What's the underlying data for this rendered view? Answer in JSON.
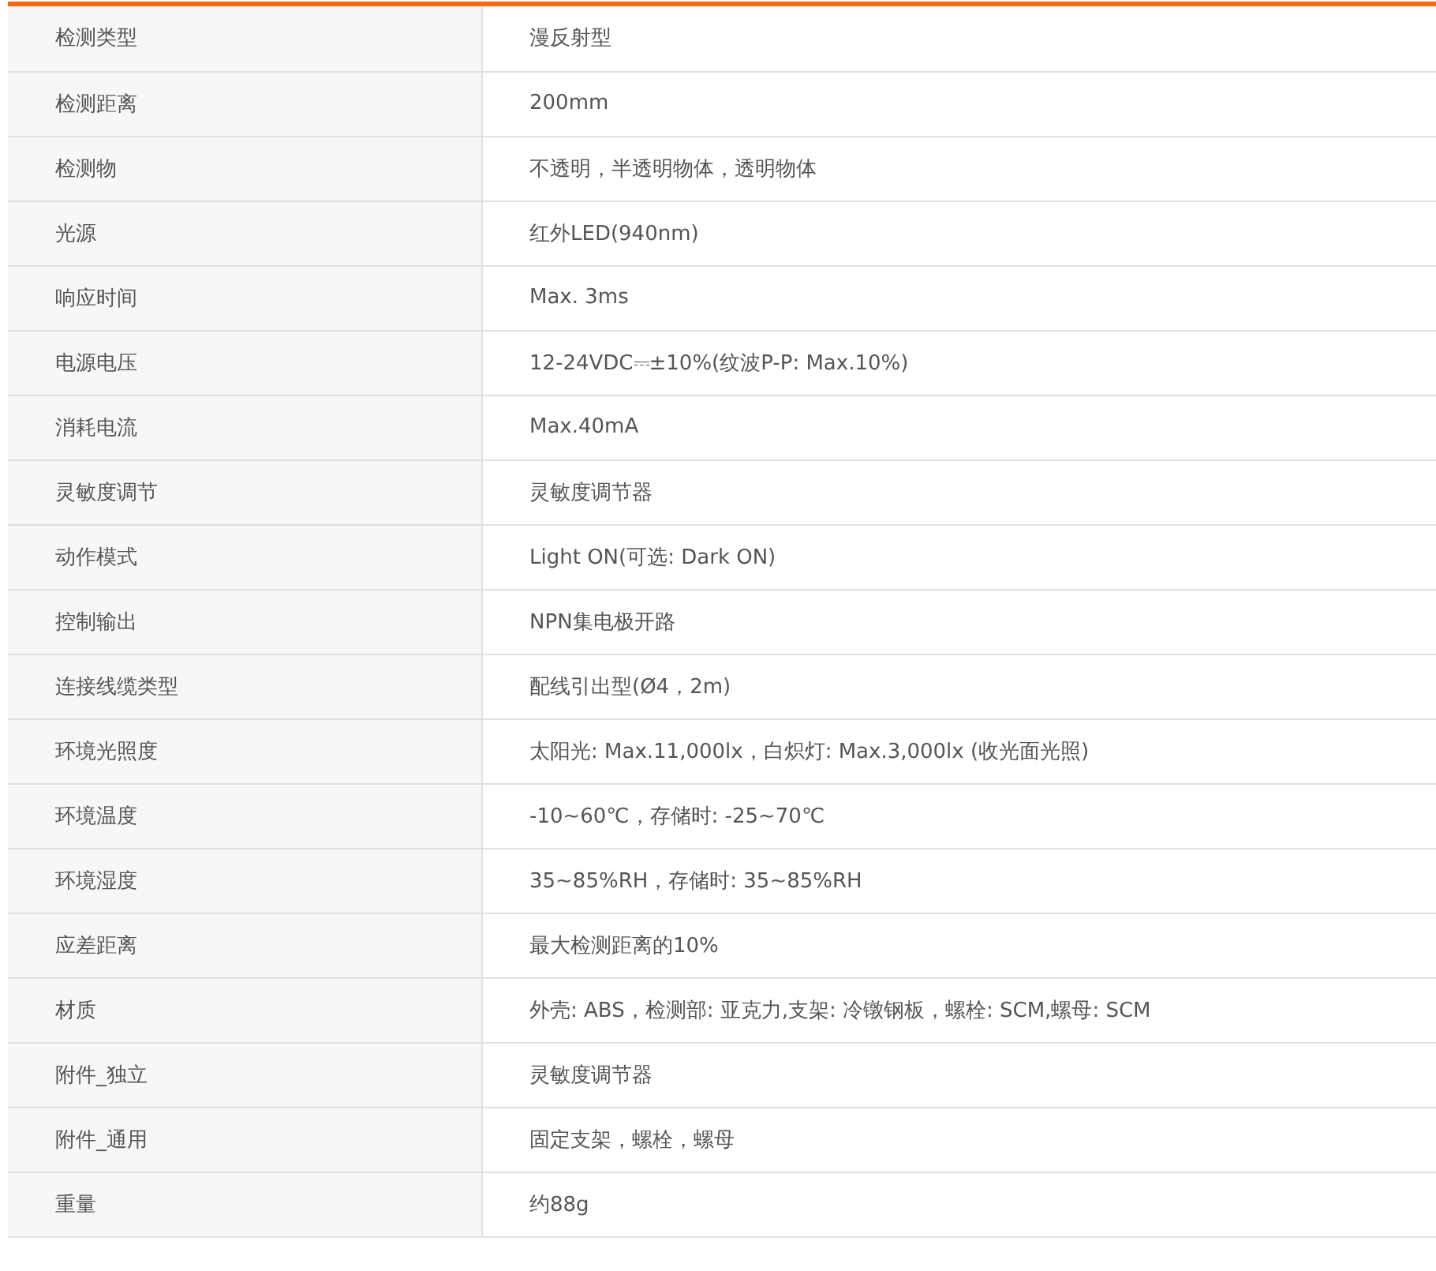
{
  "specs": [
    {
      "label": "检测类型",
      "value": "漫反射型"
    },
    {
      "label": "检测距离",
      "value": "200mm"
    },
    {
      "label": "检测物",
      "value": "不透明，半透明物体，透明物体"
    },
    {
      "label": "光源",
      "value": "红外LED(940nm)"
    },
    {
      "label": "响应时间",
      "value": "Max. 3ms"
    },
    {
      "label": "电源电压",
      "value": "12-24VDC⎓±10%(纹波P-P: Max.10%)"
    },
    {
      "label": "消耗电流",
      "value": "Max.40mA"
    },
    {
      "label": "灵敏度调节",
      "value": "灵敏度调节器"
    },
    {
      "label": "动作模式",
      "value": "Light ON(可选: Dark ON)"
    },
    {
      "label": "控制输出",
      "value": "NPN集电极开路"
    },
    {
      "label": "连接线缆类型",
      "value": "配线引出型(Ø4，2m)"
    },
    {
      "label": "环境光照度",
      "value": "太阳光: Max.11,000lx，白炽灯: Max.3,000lx (收光面光照)"
    },
    {
      "label": "环境温度",
      "value": "-10~60℃，存储时: -25~70℃"
    },
    {
      "label": "环境湿度",
      "value": "35~85%RH，存储时: 35~85%RH"
    },
    {
      "label": "应差距离",
      "value": "最大检测距离的10%"
    },
    {
      "label": "材质",
      "value": "外壳: ABS，检测部: 亚克力,支架: 冷镦钢板，螺栓: SCM,螺母: SCM"
    },
    {
      "label": "附件_独立",
      "value": "灵敏度调节器"
    },
    {
      "label": "附件_通用",
      "value": "固定支架，螺栓，螺母"
    },
    {
      "label": "重量",
      "value": "约88g"
    }
  ]
}
